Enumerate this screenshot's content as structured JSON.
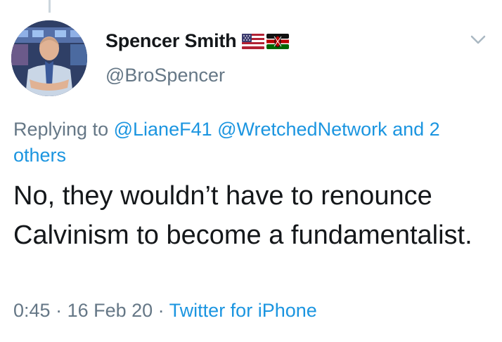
{
  "user": {
    "display_name": "Spencer Smith",
    "handle": "@BroSpencer",
    "flags": [
      "us-flag-icon",
      "kenya-flag-icon"
    ]
  },
  "reply": {
    "prefix": "Replying to",
    "mentions": "@LianeF41 @WretchedNetwork and 2 others"
  },
  "tweet": {
    "text": "No, they wouldn’t have to renounce Calvinism to become a fundamentalist."
  },
  "meta": {
    "time": "0:45",
    "sep1": " · ",
    "date": "16 Feb 20",
    "sep2": " · ",
    "source": "Twitter for iPhone"
  },
  "colors": {
    "link": "#1b95e0",
    "secondary": "#657786",
    "text": "#14171a"
  }
}
